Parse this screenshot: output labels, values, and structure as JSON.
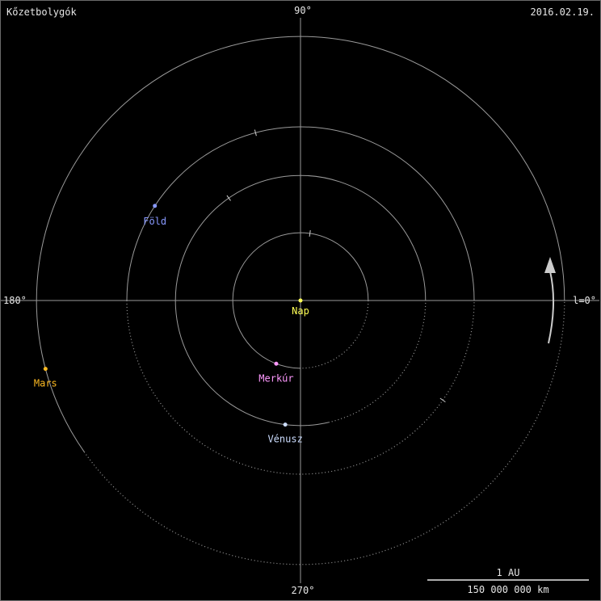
{
  "title": "Kőzetbolygók",
  "date": "2016.02.19.",
  "angle_labels": {
    "top": "90°",
    "left": "180°",
    "bottom": "270°",
    "right": "l=0°"
  },
  "sun": {
    "label": "Nap",
    "color": "#ffff55"
  },
  "planets": [
    {
      "name": "Merkúr",
      "color": "#ff99ff",
      "orbit_au": 0.39,
      "position_deg": 249
    },
    {
      "name": "Vénusz",
      "color": "#ccddff",
      "orbit_au": 0.72,
      "position_deg": 263
    },
    {
      "name": "Föld",
      "color": "#8899ff",
      "orbit_au": 1.0,
      "position_deg": 147
    },
    {
      "name": "Mars",
      "color": "#ffbb22",
      "orbit_au": 1.52,
      "position_deg": 195
    }
  ],
  "scale_bar": {
    "label_top": "1 AU",
    "label_bottom": "150 000 000 km"
  },
  "colors": {
    "background": "#000000",
    "axis": "#9a9a9a",
    "orbit": "#9a9a9a"
  }
}
